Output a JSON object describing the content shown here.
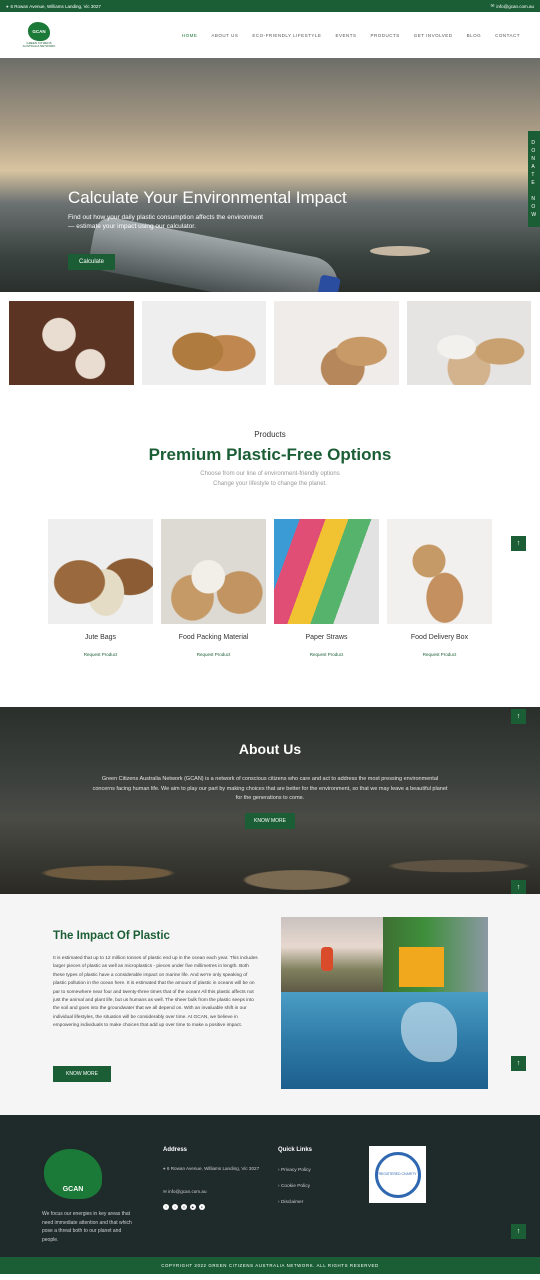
{
  "topbar": {
    "address": "6 Rowan Avenue, Williams Landing, Vic 3027",
    "email": "info@gcan.com.au"
  },
  "logo": {
    "mark": "GCAN",
    "name": "GREEN CITIZENS AUSTRALIA NETWORK"
  },
  "nav": [
    "Home",
    "About Us",
    "Eco-Friendly Lifestyle",
    "Events",
    "Products",
    "Get Involved",
    "Blog",
    "Contact"
  ],
  "donate": "DONATE NOW",
  "hero": {
    "title": "Calculate Your Environmental Impact",
    "text": "Find out how your daily plastic consumption affects the environment — estimate your impact using our calculator.",
    "button": "Calculate"
  },
  "products": {
    "kicker": "Products",
    "title": "Premium Plastic-Free Options",
    "subtitle1": "Choose from our line of environment-friendly options",
    "subtitle2": "Change your lifestyle to change the planet.",
    "items": [
      {
        "name": "Jute Bags",
        "action": "Request Product"
      },
      {
        "name": "Food Packing Material",
        "action": "Request Product"
      },
      {
        "name": "Paper Straws",
        "action": "Request Product"
      },
      {
        "name": "Food Delivery Box",
        "action": "Request Product"
      }
    ]
  },
  "about": {
    "title": "About Us",
    "text": "Green Citizens Australia Network (GCAN) is a network of conscious citizens who care and act to address the most pressing environmental concerns facing human life. We aim to play our part by making choices that are better for the environment, so that we may leave a beautiful planet for the generations to come.",
    "button": "KNOW MORE"
  },
  "impact": {
    "title": "The Impact Of Plastic",
    "text": "It is estimated that up to 12 million tonnes of plastic end up in the ocean each year. This includes larger pieces of plastic as well as microplastics - pieces under five millimetres in length. Both these types of plastic have a considerable impact on marine life. And we're only speaking of plastic pollution in the ocean here. It is estimated that the amount of plastic in oceans will be on par to somewhere near four and twenty-three times that of the ocean! All this plastic affects not just the animal and plant life, but us humans as well. The sheer bulk from the plastic seeps into the soil and goes into the groundwater that we all depend on. With an invaluable shift in our individual lifestyles, the situation will be considerably over time. At GCAN, we believe in empowering individuals to make choices that add up over time to make a positive impact.",
    "button": "KNOW MORE"
  },
  "footer": {
    "logo_text": "GCAN",
    "about": "We focus our energies in key areas that need immediate attention and that which pose a threat both to our planet and people.",
    "address_heading": "Address",
    "address": "6 Rowan Avenue, Williams Landing, Vic 3027",
    "email": "info@gcan.com.au",
    "links_heading": "Quick Links",
    "links": [
      "Privacy Policy",
      "Cookie Policy",
      "Disclaimer"
    ],
    "badge": "REGISTERED CHARITY"
  },
  "copyright": "COPYRIGHT 2022 GREEN CITIZENS AUSTRALIA NETWORK. ALL RIGHTS RESERVED",
  "colors": {
    "brand": "#1b5e35",
    "footer": "#1f2a2b"
  }
}
